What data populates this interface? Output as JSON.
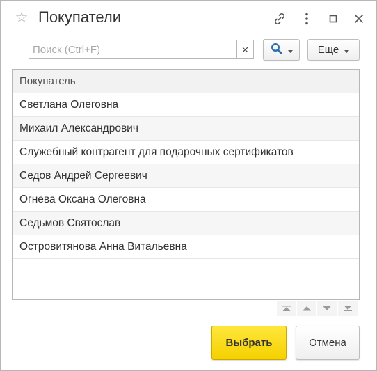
{
  "window": {
    "title": "Покупатели",
    "icons": [
      "star-icon",
      "link-icon",
      "more-vertical-icon",
      "maximize-icon",
      "close-icon"
    ]
  },
  "search": {
    "placeholder": "Поиск (Ctrl+F)",
    "value": "",
    "clear_label": "×"
  },
  "toolbar": {
    "more_label": "Еще"
  },
  "table": {
    "columns": [
      "Покупатель"
    ],
    "rows": [
      "Светлана Олеговна",
      "Михаил Александрович",
      "Служебный контрагент для подарочных сертификатов",
      "Седов Андрей Сергеевич",
      "Огнева Оксана Олеговна",
      "Седьмов Святослав",
      "Островитянова Анна Витальевна"
    ]
  },
  "navigation": [
    "first-page-icon",
    "previous-page-icon",
    "next-page-icon",
    "last-page-icon"
  ],
  "footer": {
    "select_label": "Выбрать",
    "cancel_label": "Отмена"
  },
  "colors": {
    "accent_yellow": "#f5d100",
    "border": "#b7b7b7",
    "search_icon_blue": "#2a6db5"
  }
}
